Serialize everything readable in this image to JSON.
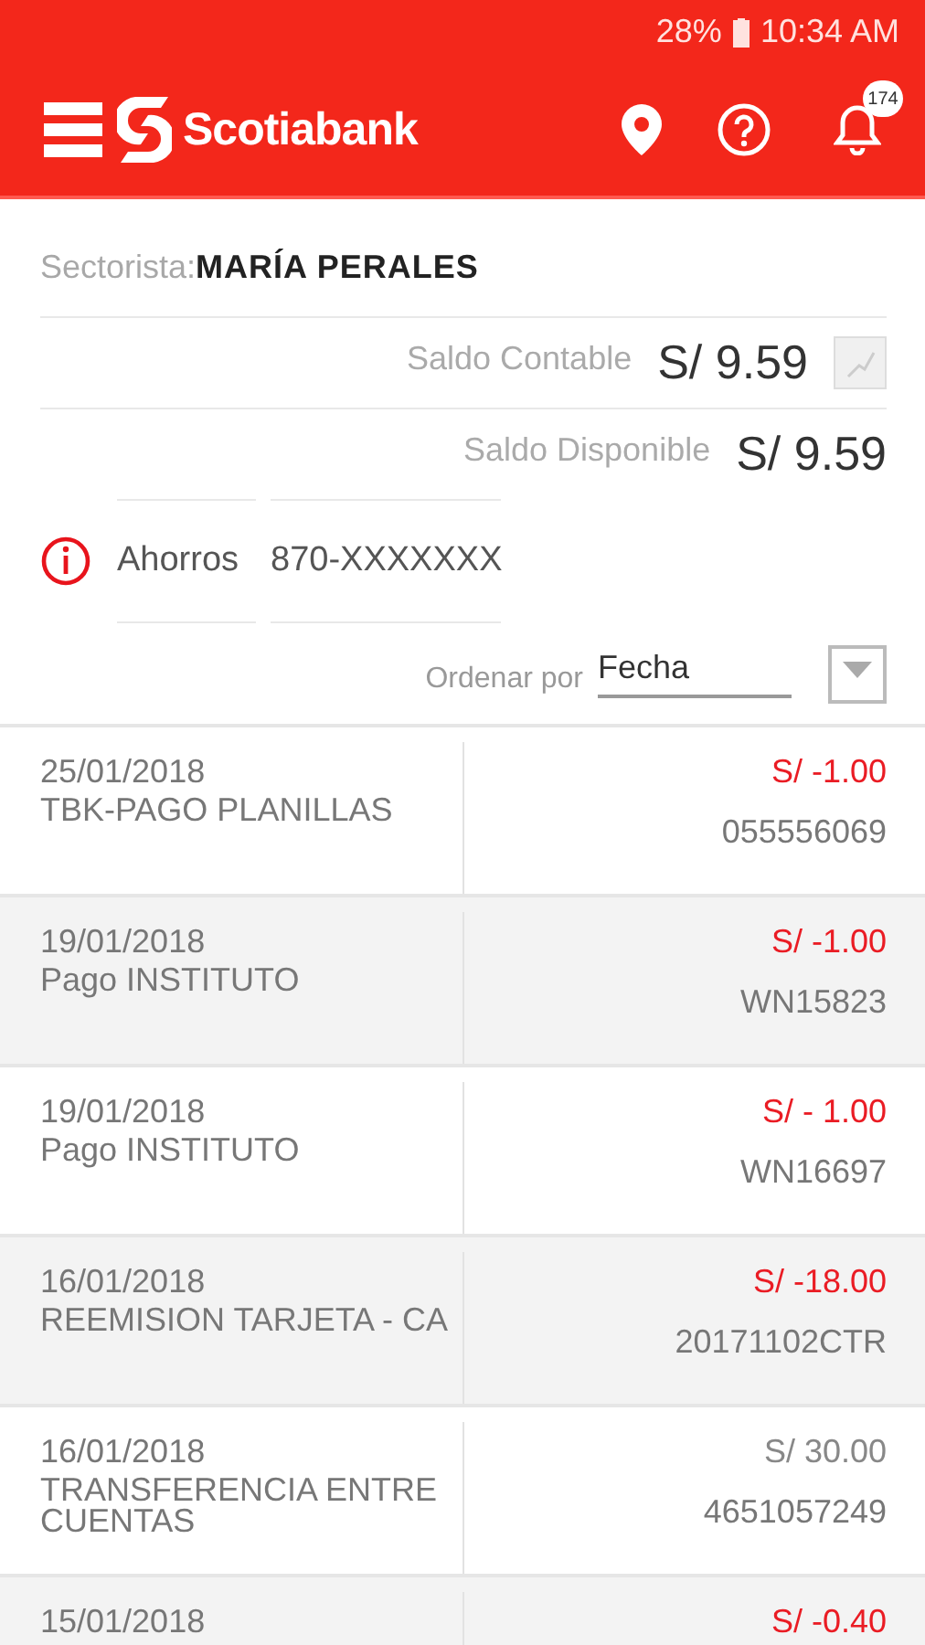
{
  "status_bar": {
    "battery": "28%",
    "time": "10:34 AM"
  },
  "app_bar": {
    "brand": "Scotiabank",
    "notification_count": "174"
  },
  "account": {
    "sectorista_label": "Sectorista:",
    "sectorista_name": "MARÍA PERALES",
    "balances": [
      {
        "label": "Saldo Contable",
        "amount": "S/ 9.59",
        "chart_button": true
      },
      {
        "label": "Saldo Disponible",
        "amount": "S/ 9.59",
        "chart_button": false
      }
    ],
    "type": "Ahorros",
    "number": "870-XXXXXXX"
  },
  "sort": {
    "label": "Ordenar por",
    "value": "Fecha"
  },
  "transactions": [
    {
      "date": "25/01/2018",
      "description": "TBK-PAGO PLANILLAS",
      "amount": "S/ -1.00",
      "kind": "debit",
      "reference": "055556069"
    },
    {
      "date": "19/01/2018",
      "description": "Pago INSTITUTO",
      "amount": "S/ -1.00",
      "kind": "debit",
      "reference": "WN15823"
    },
    {
      "date": "19/01/2018",
      "description": "Pago INSTITUTO",
      "amount": "S/ - 1.00",
      "kind": "debit",
      "reference": "WN16697"
    },
    {
      "date": "16/01/2018",
      "description": "REEMISION TARJETA - CA",
      "amount": "S/ -18.00",
      "kind": "debit",
      "reference": "20171102CTR"
    },
    {
      "date": "16/01/2018",
      "description": "TRANSFERENCIA ENTRE CUENTAS",
      "amount": "S/ 30.00",
      "kind": "credit",
      "reference": "4651057249"
    },
    {
      "date": "15/01/2018",
      "amount": "S/ -0.40",
      "kind": "debit"
    }
  ]
}
